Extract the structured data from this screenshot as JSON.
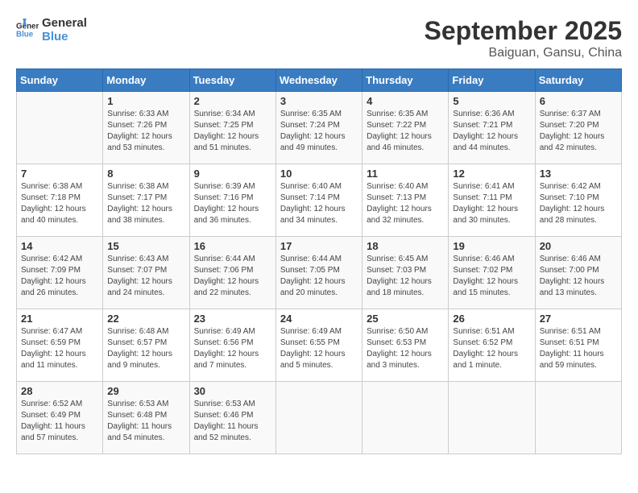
{
  "header": {
    "logo_line1": "General",
    "logo_line2": "Blue",
    "month_title": "September 2025",
    "location": "Baiguan, Gansu, China"
  },
  "days_of_week": [
    "Sunday",
    "Monday",
    "Tuesday",
    "Wednesday",
    "Thursday",
    "Friday",
    "Saturday"
  ],
  "weeks": [
    [
      {
        "day": "",
        "info": ""
      },
      {
        "day": "1",
        "info": "Sunrise: 6:33 AM\nSunset: 7:26 PM\nDaylight: 12 hours\nand 53 minutes."
      },
      {
        "day": "2",
        "info": "Sunrise: 6:34 AM\nSunset: 7:25 PM\nDaylight: 12 hours\nand 51 minutes."
      },
      {
        "day": "3",
        "info": "Sunrise: 6:35 AM\nSunset: 7:24 PM\nDaylight: 12 hours\nand 49 minutes."
      },
      {
        "day": "4",
        "info": "Sunrise: 6:35 AM\nSunset: 7:22 PM\nDaylight: 12 hours\nand 46 minutes."
      },
      {
        "day": "5",
        "info": "Sunrise: 6:36 AM\nSunset: 7:21 PM\nDaylight: 12 hours\nand 44 minutes."
      },
      {
        "day": "6",
        "info": "Sunrise: 6:37 AM\nSunset: 7:20 PM\nDaylight: 12 hours\nand 42 minutes."
      }
    ],
    [
      {
        "day": "7",
        "info": "Sunrise: 6:38 AM\nSunset: 7:18 PM\nDaylight: 12 hours\nand 40 minutes."
      },
      {
        "day": "8",
        "info": "Sunrise: 6:38 AM\nSunset: 7:17 PM\nDaylight: 12 hours\nand 38 minutes."
      },
      {
        "day": "9",
        "info": "Sunrise: 6:39 AM\nSunset: 7:16 PM\nDaylight: 12 hours\nand 36 minutes."
      },
      {
        "day": "10",
        "info": "Sunrise: 6:40 AM\nSunset: 7:14 PM\nDaylight: 12 hours\nand 34 minutes."
      },
      {
        "day": "11",
        "info": "Sunrise: 6:40 AM\nSunset: 7:13 PM\nDaylight: 12 hours\nand 32 minutes."
      },
      {
        "day": "12",
        "info": "Sunrise: 6:41 AM\nSunset: 7:11 PM\nDaylight: 12 hours\nand 30 minutes."
      },
      {
        "day": "13",
        "info": "Sunrise: 6:42 AM\nSunset: 7:10 PM\nDaylight: 12 hours\nand 28 minutes."
      }
    ],
    [
      {
        "day": "14",
        "info": "Sunrise: 6:42 AM\nSunset: 7:09 PM\nDaylight: 12 hours\nand 26 minutes."
      },
      {
        "day": "15",
        "info": "Sunrise: 6:43 AM\nSunset: 7:07 PM\nDaylight: 12 hours\nand 24 minutes."
      },
      {
        "day": "16",
        "info": "Sunrise: 6:44 AM\nSunset: 7:06 PM\nDaylight: 12 hours\nand 22 minutes."
      },
      {
        "day": "17",
        "info": "Sunrise: 6:44 AM\nSunset: 7:05 PM\nDaylight: 12 hours\nand 20 minutes."
      },
      {
        "day": "18",
        "info": "Sunrise: 6:45 AM\nSunset: 7:03 PM\nDaylight: 12 hours\nand 18 minutes."
      },
      {
        "day": "19",
        "info": "Sunrise: 6:46 AM\nSunset: 7:02 PM\nDaylight: 12 hours\nand 15 minutes."
      },
      {
        "day": "20",
        "info": "Sunrise: 6:46 AM\nSunset: 7:00 PM\nDaylight: 12 hours\nand 13 minutes."
      }
    ],
    [
      {
        "day": "21",
        "info": "Sunrise: 6:47 AM\nSunset: 6:59 PM\nDaylight: 12 hours\nand 11 minutes."
      },
      {
        "day": "22",
        "info": "Sunrise: 6:48 AM\nSunset: 6:57 PM\nDaylight: 12 hours\nand 9 minutes."
      },
      {
        "day": "23",
        "info": "Sunrise: 6:49 AM\nSunset: 6:56 PM\nDaylight: 12 hours\nand 7 minutes."
      },
      {
        "day": "24",
        "info": "Sunrise: 6:49 AM\nSunset: 6:55 PM\nDaylight: 12 hours\nand 5 minutes."
      },
      {
        "day": "25",
        "info": "Sunrise: 6:50 AM\nSunset: 6:53 PM\nDaylight: 12 hours\nand 3 minutes."
      },
      {
        "day": "26",
        "info": "Sunrise: 6:51 AM\nSunset: 6:52 PM\nDaylight: 12 hours\nand 1 minute."
      },
      {
        "day": "27",
        "info": "Sunrise: 6:51 AM\nSunset: 6:51 PM\nDaylight: 11 hours\nand 59 minutes."
      }
    ],
    [
      {
        "day": "28",
        "info": "Sunrise: 6:52 AM\nSunset: 6:49 PM\nDaylight: 11 hours\nand 57 minutes."
      },
      {
        "day": "29",
        "info": "Sunrise: 6:53 AM\nSunset: 6:48 PM\nDaylight: 11 hours\nand 54 minutes."
      },
      {
        "day": "30",
        "info": "Sunrise: 6:53 AM\nSunset: 6:46 PM\nDaylight: 11 hours\nand 52 minutes."
      },
      {
        "day": "",
        "info": ""
      },
      {
        "day": "",
        "info": ""
      },
      {
        "day": "",
        "info": ""
      },
      {
        "day": "",
        "info": ""
      }
    ]
  ]
}
